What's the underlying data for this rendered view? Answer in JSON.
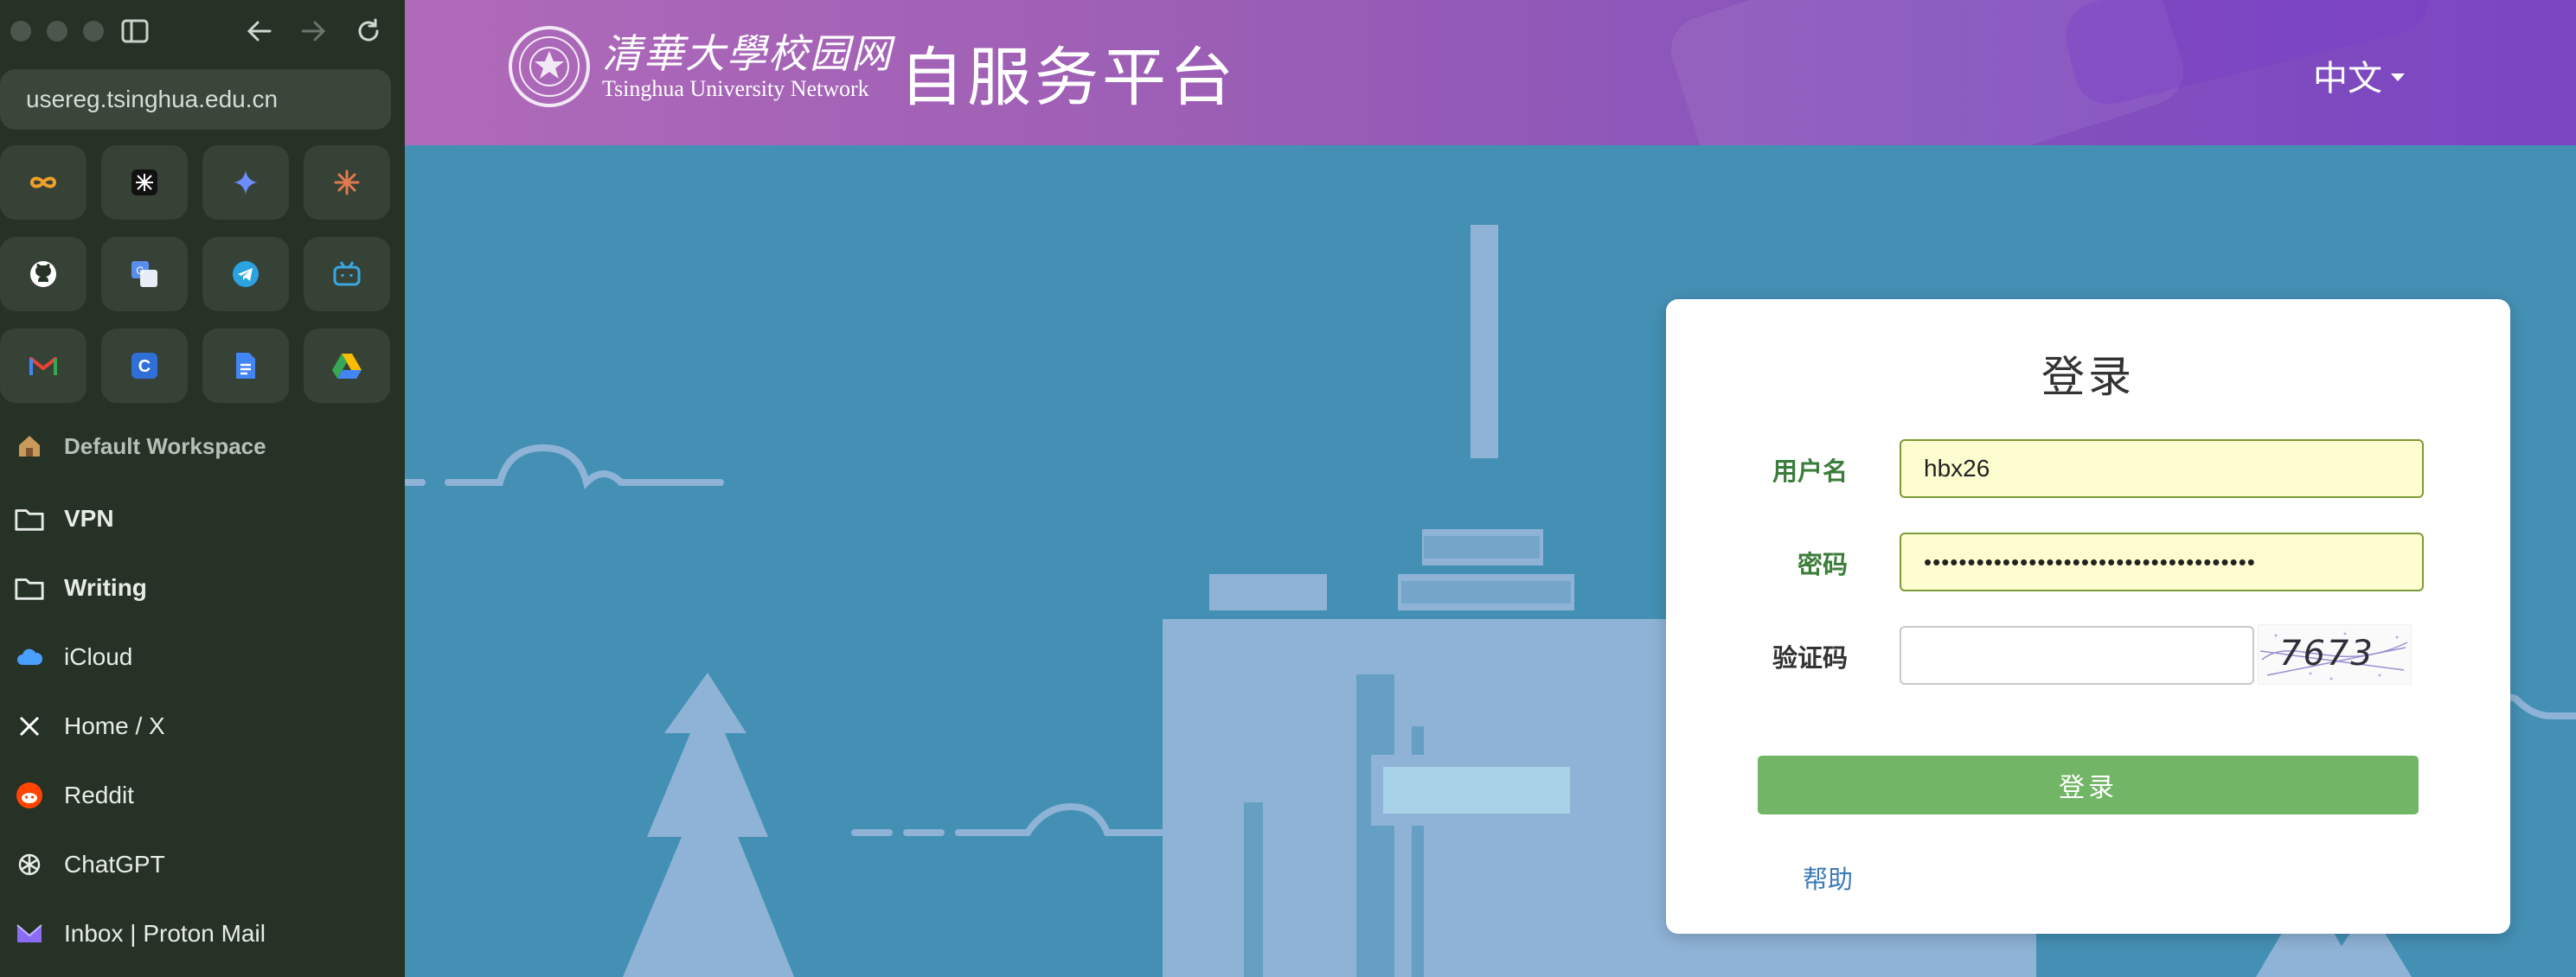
{
  "browser": {
    "url": "usereg.tsinghua.edu.cn",
    "favorites": [
      {
        "name": "infinity-icon",
        "color": "#f0a02a"
      },
      {
        "name": "deepwiki-icon",
        "color": "#ffffff"
      },
      {
        "name": "gemini-icon",
        "color": "#6f8cff"
      },
      {
        "name": "claude-icon",
        "color": "#e07a4f"
      },
      {
        "name": "github-icon",
        "color": "#ffffff"
      },
      {
        "name": "google-translate-icon",
        "color": "#5b8def"
      },
      {
        "name": "telegram-icon",
        "color": "#2aa3e0"
      },
      {
        "name": "bilibili-icon",
        "color": "#39a7e0"
      },
      {
        "name": "gmail-icon",
        "color": "#ea4335"
      },
      {
        "name": "c-app-icon",
        "color": "#2f6fd8"
      },
      {
        "name": "google-docs-icon",
        "color": "#4285f4"
      },
      {
        "name": "google-drive-icon",
        "color": "#34a853"
      }
    ],
    "workspace": "Default Workspace",
    "folders": [
      "VPN",
      "Writing"
    ],
    "tabs": [
      {
        "label": "iCloud",
        "icon": "icloud-icon"
      },
      {
        "label": "Home / X",
        "icon": "x-icon"
      },
      {
        "label": "Reddit",
        "icon": "reddit-icon"
      },
      {
        "label": "ChatGPT",
        "icon": "chatgpt-icon"
      },
      {
        "label": "Inbox | Proton Mail",
        "icon": "proton-mail-icon"
      }
    ]
  },
  "header": {
    "logo_cn": "清華大學校园网",
    "logo_en": "Tsinghua University Network",
    "platform_title": "自服务平台",
    "language": "中文"
  },
  "login": {
    "title": "登录",
    "username_label": "用户名",
    "username_value": "hbx26",
    "password_label": "密码",
    "password_value": "••••••••••••••••••••••••••••••••••••••",
    "captcha_label": "验证码",
    "captcha_value": "",
    "captcha_text": "7673",
    "submit_label": "登录",
    "help_label": "帮助"
  },
  "colors": {
    "page_bg": "#4490b4",
    "art": "#8fb3d6",
    "header_start": "#b06ab9",
    "header_end": "#7b45c2",
    "button": "#72b566",
    "label_green": "#3b7d3b",
    "link": "#3d7ab7"
  }
}
